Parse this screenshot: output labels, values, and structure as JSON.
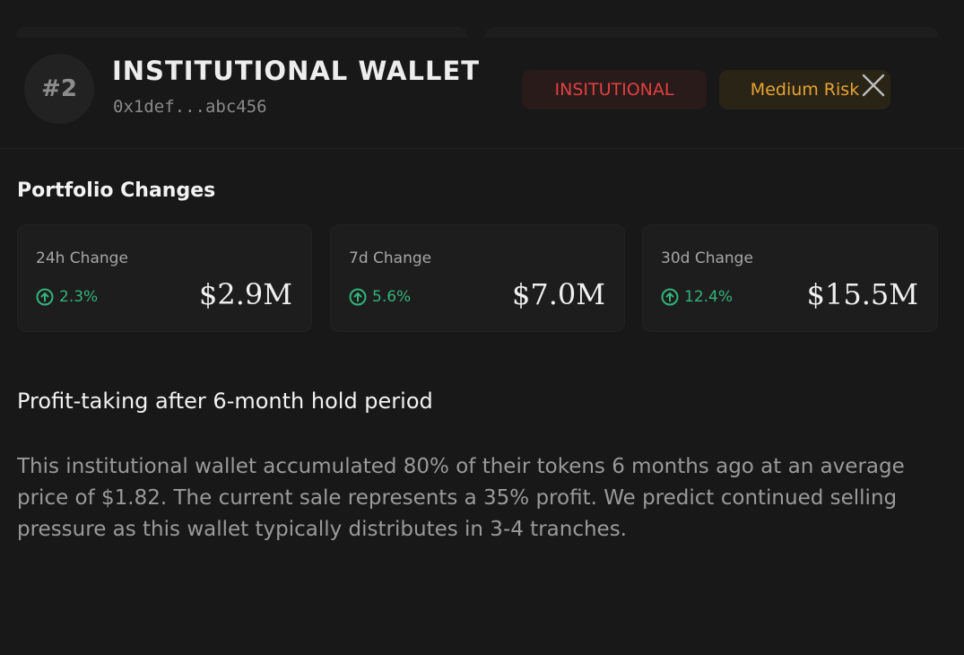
{
  "wallet": {
    "rank": "#2",
    "title": "INSTITUTIONAL WALLET",
    "address": "0x1def...abc456",
    "type_badge": "INSITUTIONAL",
    "risk_badge": "Medium Risk"
  },
  "portfolio": {
    "section_title": "Portfolio Changes",
    "changes": [
      {
        "label": "24h Change",
        "percent": "2.3%",
        "value": "$2.9M"
      },
      {
        "label": "7d Change",
        "percent": "5.6%",
        "value": "$7.0M"
      },
      {
        "label": "30d Change",
        "percent": "12.4%",
        "value": "$15.5M"
      }
    ]
  },
  "analysis": {
    "title": "Profit-taking after 6-month hold period",
    "body": "This institutional wallet accumulated 80% of their tokens 6 months ago at an average price of $1.82. The current sale represents a 35% profit. We predict continued selling pressure as this wallet typically distributes in 3-4 tranches."
  },
  "icons": {
    "close": "close-icon",
    "change_up": "arrow-up-circle-icon"
  },
  "colors": {
    "background": "#181818",
    "positive": "#34b27b",
    "type_badge_text": "#e0403f",
    "risk_badge_text": "#e6a431"
  }
}
